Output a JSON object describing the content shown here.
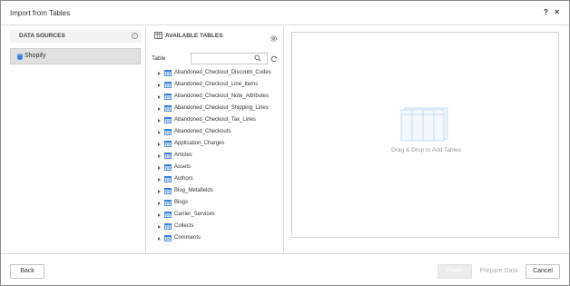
{
  "dialog": {
    "title": "Import from Tables",
    "help_label": "?",
    "close_label": "×"
  },
  "sources": {
    "header": "DATA SOURCES",
    "items": [
      {
        "label": "Shopify"
      }
    ]
  },
  "tables": {
    "header": "AVAILABLE TABLES",
    "search_label": "Table",
    "search_value": "",
    "items": [
      "Abandoned_Checkout_Discount_Codes",
      "Abandoned_Checkout_Line_Items",
      "Abandoned_Checkout_Note_Attributes",
      "Abandoned_Checkout_Shipping_Lines",
      "Abandoned_Checkout_Tax_Lines",
      "Abandoned_Checkouts",
      "Application_Charges",
      "Articles",
      "Assets",
      "Authors",
      "Blog_Metafields",
      "Blogs",
      "Carrier_Services",
      "Collects",
      "Comments"
    ]
  },
  "drop_zone": {
    "hint": "Drag & Drop to Add Tables"
  },
  "footer": {
    "back_label": "Back",
    "finish_label": "Finish",
    "prepare_label": "Prepare Data",
    "cancel_label": "Cancel"
  },
  "colors": {
    "table_icon": "#3b7dd8",
    "drop_graphic": "#c9dcf2",
    "selected_bg": "#e0e0e0"
  }
}
